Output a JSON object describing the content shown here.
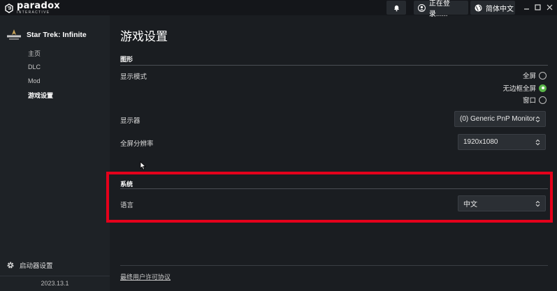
{
  "topbar": {
    "logo_text": "paradox",
    "logo_sub": "INTERACTIVE",
    "notify_icon": "bell-icon",
    "login_status": "正在登录......",
    "language_label": "简体中文",
    "globe_icon": "globe-icon"
  },
  "sidebar": {
    "game_title": "Star Trek: Infinite",
    "items": [
      {
        "label": "主页",
        "active": false
      },
      {
        "label": "DLC",
        "active": false
      },
      {
        "label": "Mod",
        "active": false
      },
      {
        "label": "游戏设置",
        "active": true
      }
    ],
    "launcher_settings": "启动器设置",
    "version": "2023.13.1"
  },
  "main": {
    "page_title": "游戏设置",
    "graphics": {
      "section_title": "图形",
      "display_mode_label": "显示模式",
      "display_mode_options": [
        {
          "label": "全屏",
          "selected": false
        },
        {
          "label": "无边框全屏",
          "selected": true
        },
        {
          "label": "窗口",
          "selected": false
        }
      ],
      "monitor_label": "显示器",
      "monitor_value": "(0) Generic PnP Monitor",
      "resolution_label": "全屏分辨率",
      "resolution_value": "1920x1080"
    },
    "system": {
      "section_title": "系统",
      "language_label": "语言",
      "language_value": "中文"
    },
    "eula": "最终用户许可协议"
  },
  "colors": {
    "accent_green": "#5ab54a",
    "highlight_red": "#e4001b",
    "background": "#1a1d21"
  }
}
